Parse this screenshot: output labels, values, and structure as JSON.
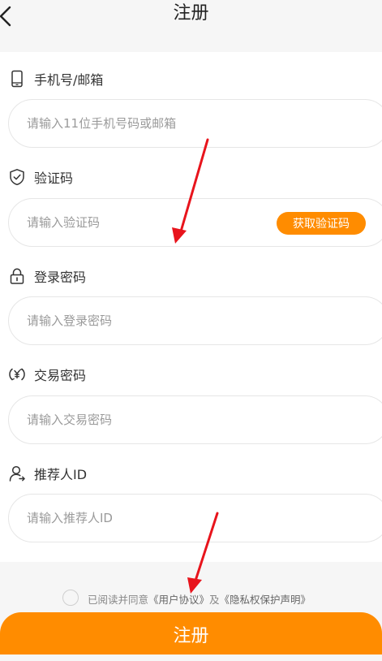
{
  "header": {
    "title": "注册"
  },
  "fields": [
    {
      "label": "手机号/邮箱",
      "icon": "phone-icon",
      "placeholder": "请输入11位手机号码或邮箱"
    },
    {
      "label": "验证码",
      "icon": "shield-check-icon",
      "placeholder": "请输入验证码",
      "action_label": "获取验证码"
    },
    {
      "label": "登录密码",
      "icon": "lock-icon",
      "placeholder": "请输入登录密码"
    },
    {
      "label": "交易密码",
      "icon": "yuan-exchange-icon",
      "placeholder": "请输入交易密码"
    },
    {
      "label": "推荐人ID",
      "icon": "user-referral-icon",
      "placeholder": "请输入推荐人ID"
    }
  ],
  "agreement": {
    "prefix": "已阅读并同意",
    "user_agreement": "《用户协议》",
    "joiner": "及",
    "privacy": "《隐私权保护声明》"
  },
  "submit_label": "注册",
  "colors": {
    "accent": "#ff8c00",
    "annotation_arrow": "#e8141c",
    "page_bg": "#f6f6f6"
  }
}
